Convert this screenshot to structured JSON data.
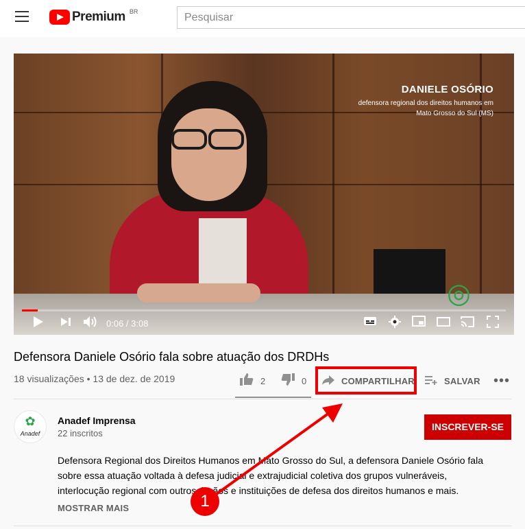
{
  "header": {
    "logo_text": "Premium",
    "logo_region": "BR",
    "search_placeholder": "Pesquisar"
  },
  "video": {
    "caption_name": "DANIELE OSÓRIO",
    "caption_role_1": "defensora regional dos direitos humanos em",
    "caption_role_2": "Mato Grosso do Sul (MS)",
    "time": "0:06 / 3:08",
    "progress_fraction": 0.032
  },
  "info": {
    "title": "Defensora Daniele Osório fala sobre atuação dos DRDHs",
    "meta": "18 visualizações • 13 de dez. de 2019",
    "likes": "2",
    "dislikes": "0",
    "share_label": "COMPARTILHAR",
    "save_label": "SALVAR"
  },
  "channel": {
    "avatar_label": "Anadef",
    "name": "Anadef Imprensa",
    "subscribers": "22 inscritos",
    "subscribe_label": "INSCREVER-SE",
    "description": [
      "Defensora Regional dos Direitos Humanos em Mato Grosso do Sul, a defensora Daniele Osório fala",
      "sobre essa atuação voltada à defesa judicial e extrajudicial coletiva dos grupos vulneráveis,",
      "interlocução regional com outros órgãos e instituições de defesa dos direitos humanos e mais."
    ],
    "show_more": "MOSTRAR MAIS"
  },
  "annotation": {
    "badge_number": "1",
    "color": "#ee0000"
  }
}
